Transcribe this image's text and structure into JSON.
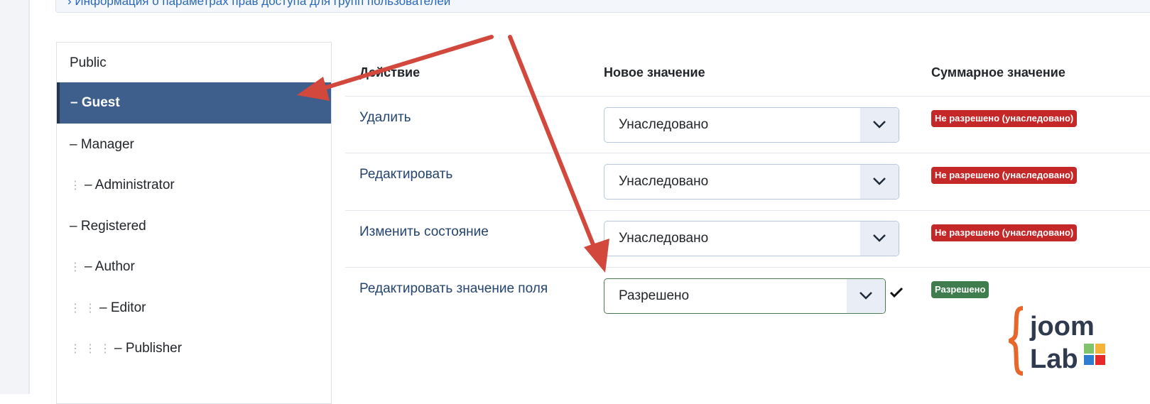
{
  "info_bar": {
    "text": "› Информация о параметрах прав доступа для групп пользователей"
  },
  "groups": [
    {
      "label": "Public",
      "depth": 0,
      "active": false
    },
    {
      "label": "– Guest",
      "depth": 0,
      "active": true
    },
    {
      "label": "– Manager",
      "depth": 0,
      "active": false
    },
    {
      "label": "– Administrator",
      "depth": 1,
      "active": false
    },
    {
      "label": "– Registered",
      "depth": 0,
      "active": false
    },
    {
      "label": "– Author",
      "depth": 1,
      "active": false
    },
    {
      "label": "– Editor",
      "depth": 2,
      "active": false
    },
    {
      "label": "– Publisher",
      "depth": 3,
      "active": false
    }
  ],
  "table": {
    "headers": {
      "action": "Действие",
      "new_value": "Новое значение",
      "calculated": "Суммарное значение"
    },
    "rows": [
      {
        "action": "Удалить",
        "value": "Унаследовано",
        "calculated": "Не разрешено (унаследовано)",
        "status": "denied"
      },
      {
        "action": "Редактировать",
        "value": "Унаследовано",
        "calculated": "Не разрешено (унаследовано)",
        "status": "denied"
      },
      {
        "action": "Изменить состояние",
        "value": "Унаследовано",
        "calculated": "Не разрешено (унаследовано)",
        "status": "denied"
      },
      {
        "action": "Редактировать значение поля",
        "value": "Разрешено",
        "calculated": "Разрешено",
        "status": "allowed"
      }
    ]
  },
  "colors": {
    "active_group": "#3e5f8c",
    "denied": "#c52828",
    "allowed": "#3f7d4f",
    "annotation_arrow": "#d2483c"
  },
  "logo": {
    "line1": "joom",
    "line2": "Lab"
  }
}
